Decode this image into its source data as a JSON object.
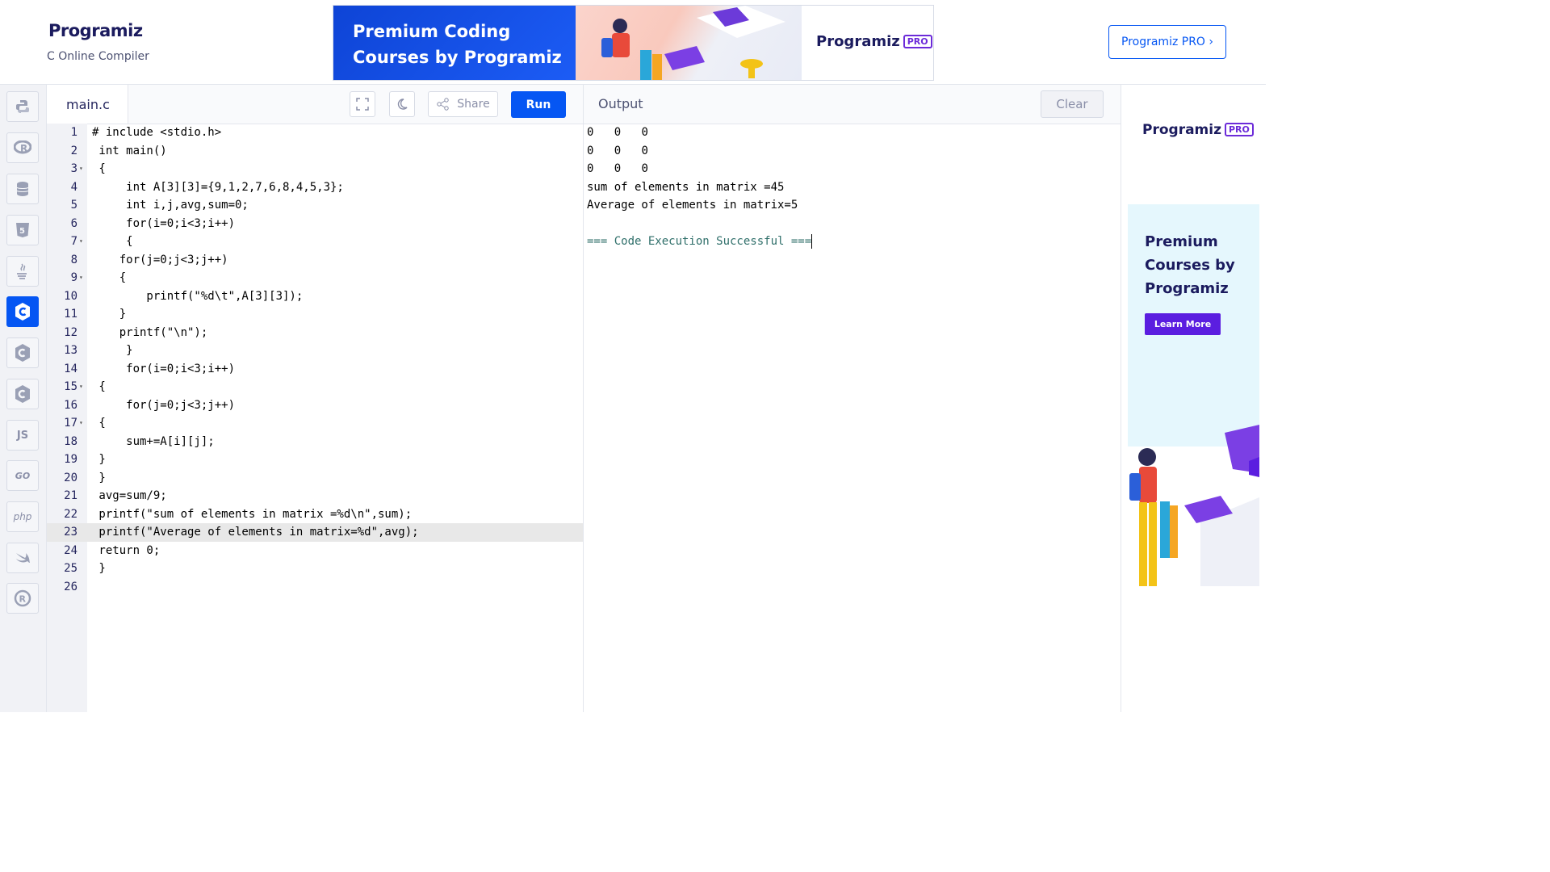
{
  "header": {
    "logo": "Programiz",
    "subtitle": "C Online Compiler",
    "banner_line1": "Premium Coding",
    "banner_line2": "Courses by Programiz",
    "banner_brand": "Programiz",
    "banner_pro": "PRO",
    "pro_button": "Programiz PRO ›"
  },
  "sidebar": {
    "items": [
      {
        "name": "python",
        "glyph": "🐍"
      },
      {
        "name": "r",
        "glyph": "R"
      },
      {
        "name": "sql",
        "glyph": "≡"
      },
      {
        "name": "html",
        "glyph": "5"
      },
      {
        "name": "java",
        "glyph": "☕"
      },
      {
        "name": "c",
        "glyph": "C"
      },
      {
        "name": "cpp",
        "glyph": "C"
      },
      {
        "name": "csharp",
        "glyph": "C"
      },
      {
        "name": "js",
        "glyph": "JS"
      },
      {
        "name": "go",
        "glyph": "GO"
      },
      {
        "name": "php",
        "glyph": "php"
      },
      {
        "name": "swift",
        "glyph": "➶"
      },
      {
        "name": "rust",
        "glyph": "R"
      }
    ]
  },
  "editor": {
    "tab": "main.c",
    "share": "Share",
    "run": "Run",
    "lines": [
      "# include <stdio.h>",
      " int main()",
      " {",
      "     int A[3][3]={9,1,2,7,6,8,4,5,3};",
      "     int i,j,avg,sum=0;",
      "     for(i=0;i<3;i++)",
      "     {",
      "    for(j=0;j<3;j++)",
      "    {",
      "        printf(\"%d\\t\",A[3][3]);",
      "    }",
      "    printf(\"\\n\");",
      "     }",
      "     for(i=0;i<3;i++)",
      " {",
      "     for(j=0;j<3;j++)",
      " {",
      "     sum+=A[i][j];",
      " }",
      " }",
      " avg=sum/9;",
      " printf(\"sum of elements in matrix =%d\\n\",sum);",
      " printf(\"Average of elements in matrix=%d\",avg);",
      " return 0;",
      " }",
      ""
    ],
    "fold_lines": [
      3,
      7,
      9,
      15,
      17
    ],
    "active_line": 23
  },
  "output": {
    "title": "Output",
    "clear": "Clear",
    "lines": [
      "0\t0\t0",
      "0\t0\t0",
      "0\t0\t0",
      "sum of elements in matrix =45",
      "Average of elements in matrix=5",
      "",
      "=== Code Execution Successful ==="
    ]
  },
  "ad": {
    "brand": "Programiz",
    "pro": "PRO",
    "headline": [
      "Premium",
      "Courses by",
      "Programiz"
    ],
    "button": "Learn More"
  }
}
